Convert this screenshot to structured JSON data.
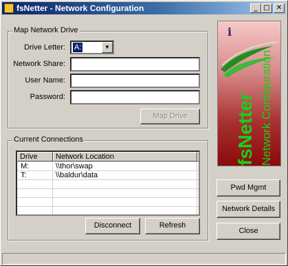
{
  "window": {
    "title": "fsNetter - Network Configuration",
    "controls": {
      "minimize": "_",
      "maximize": "□",
      "close": "✕"
    }
  },
  "map_drive": {
    "legend": "Map Network Drive",
    "drive_letter_label": "Drive Letter:",
    "drive_letter_value": "A:",
    "network_share_label": "Network Share:",
    "network_share_value": "",
    "user_name_label": "User Name:",
    "user_name_value": "",
    "password_label": "Password:",
    "password_value": "",
    "map_button": "Map Drive"
  },
  "connections": {
    "legend": "Current Connections",
    "columns": [
      "Drive",
      "Network Location"
    ],
    "rows": [
      {
        "drive": "M:",
        "location": "\\\\thor\\swap"
      },
      {
        "drive": "T:",
        "location": "\\\\baldur\\data"
      },
      {
        "drive": "",
        "location": ""
      },
      {
        "drive": "",
        "location": ""
      },
      {
        "drive": "",
        "location": ""
      },
      {
        "drive": "",
        "location": ""
      }
    ],
    "disconnect_button": "Disconnect",
    "refresh_button": "Refresh"
  },
  "logo": {
    "info_glyph": "i",
    "name": "fsNetter",
    "subtitle": "Network Configuration"
  },
  "side_buttons": {
    "pwd_mgmt": "Pwd Mgmt",
    "network_details": "Network Details",
    "close": "Close"
  },
  "status": {
    "text": ""
  }
}
